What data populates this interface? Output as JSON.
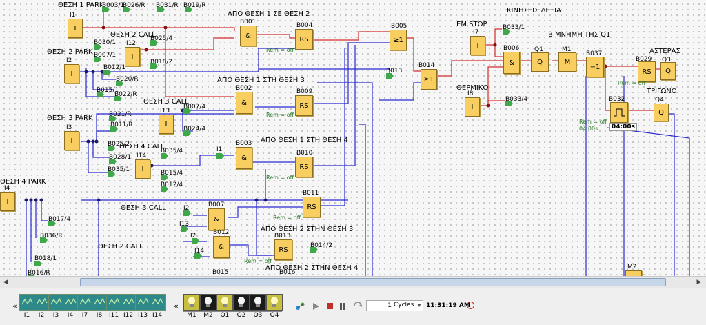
{
  "diagram": {
    "titles": [
      {
        "text": "ΘΕΣΗ 1 PARK"
      },
      {
        "text": "ΑΠΟ ΘΕΣΗ 1 ΣΕ ΘΕΣΗ 2"
      },
      {
        "text": "ΘΕΣΗ 2 CALL"
      },
      {
        "text": "ΘΕΣΗ 2 PARK"
      },
      {
        "text": "ΑΠΟ ΘΕΣΗ 1 ΣΤΗ ΘΕΣΗ 3"
      },
      {
        "text": "ΘΕΣΗ 3 CALL"
      },
      {
        "text": "ΘΕΣΗ 3 PARK"
      },
      {
        "text": "ΘΕΣΗ 4 CALL"
      },
      {
        "text": "ΑΠΟ ΘΕΣΗ 1 ΣΤΗ ΘΕΣΗ 4"
      },
      {
        "text": "ΘΕΣΗ 4 PARK"
      },
      {
        "text": "ΘΕΣΗ 3 CALL"
      },
      {
        "text": "ΑΠΟ ΘΕΣΗ 2 ΣΤΗΝ ΘΕΣΗ 3"
      },
      {
        "text": "ΘΕΣΗ 2 CALL"
      },
      {
        "text": "ΑΠΟ ΘΕΣΗ 2 ΣΤΗΝ ΘΕΣΗ 4"
      },
      {
        "text": "ΚΙΝΗΣΕΙΣ ΔΕΞΙΑ"
      },
      {
        "text": "EM.STOP"
      },
      {
        "text": "Β.ΜΝΗΜΗ ΤΗΣ Q1"
      },
      {
        "text": "ΑΣΤΕΡΑΣ"
      },
      {
        "text": "ΘΕΡΜΙΚΟ"
      },
      {
        "text": "ΤΡΙΓΩΝΟ"
      }
    ],
    "blocks": [
      {
        "id": "I1",
        "sym": "I"
      },
      {
        "id": "I12",
        "sym": "I"
      },
      {
        "id": "I2",
        "sym": "I"
      },
      {
        "id": "I3",
        "sym": "I"
      },
      {
        "id": "I13",
        "sym": "I"
      },
      {
        "id": "I14",
        "sym": "I"
      },
      {
        "id": "I4",
        "sym": "I"
      },
      {
        "id": "I7",
        "sym": "I"
      },
      {
        "id": "I8",
        "sym": "I"
      },
      {
        "id": "B001",
        "sym": "&"
      },
      {
        "id": "B002",
        "sym": "&"
      },
      {
        "id": "B003",
        "sym": "&"
      },
      {
        "id": "B007",
        "sym": "&"
      },
      {
        "id": "B012",
        "sym": "&"
      },
      {
        "id": "B006",
        "sym": "&"
      },
      {
        "id": "B004",
        "sym": "RS"
      },
      {
        "id": "B009",
        "sym": "RS"
      },
      {
        "id": "B010",
        "sym": "RS"
      },
      {
        "id": "B011",
        "sym": "RS"
      },
      {
        "id": "B013",
        "sym": "RS"
      },
      {
        "id": "B029",
        "sym": "RS"
      },
      {
        "id": "B005",
        "sym": "≥1"
      },
      {
        "id": "B014",
        "sym": "≥1"
      },
      {
        "id": "B037",
        "sym": "=1"
      },
      {
        "id": "Q1",
        "sym": "Q"
      },
      {
        "id": "M1",
        "sym": "M"
      },
      {
        "id": "Q3",
        "sym": "Q"
      },
      {
        "id": "Q4",
        "sym": "Q"
      },
      {
        "id": "B032",
        "sym": ""
      }
    ],
    "tags": [
      "B003/1",
      "B026/R",
      "B031/R",
      "B019/R",
      "B025/4",
      "B030/1",
      "B007/1",
      "B018/2",
      "B012/1",
      "B020/R",
      "B015/1",
      "B022/R",
      "B021/R",
      "B011/R",
      "B025/2",
      "B028/1",
      "B035/1",
      "B007/4",
      "B024/4",
      "B035/4",
      "B015/4",
      "B012/4",
      "B017/4",
      "B036/R",
      "B018/1",
      "B016/R",
      "B014/2",
      "B033/1",
      "B033/4",
      "I1",
      "I2",
      "I13",
      "I14",
      "I2",
      "B013",
      "B015",
      "B016"
    ],
    "remanence": "Rem = off",
    "timer_value": "04:00s",
    "timer_rem": "04:00s",
    "m2_label": "M2"
  },
  "toolbar": {
    "inputs": [
      "I1",
      "I2",
      "I3",
      "I4",
      "I7",
      "I8",
      "I11",
      "I12",
      "I13",
      "I14"
    ],
    "outputs": [
      {
        "label": "M1",
        "on": true
      },
      {
        "label": "M2",
        "on": false
      },
      {
        "label": "Q1",
        "on": true
      },
      {
        "label": "Q2",
        "on": false
      },
      {
        "label": "Q3",
        "on": false
      },
      {
        "label": "Q4",
        "on": true
      }
    ],
    "cycles_value": "1",
    "cycles_label": "Cycles",
    "time": "11:31:19 AM",
    "scroll_left": "«",
    "scroll_left2": "«"
  }
}
